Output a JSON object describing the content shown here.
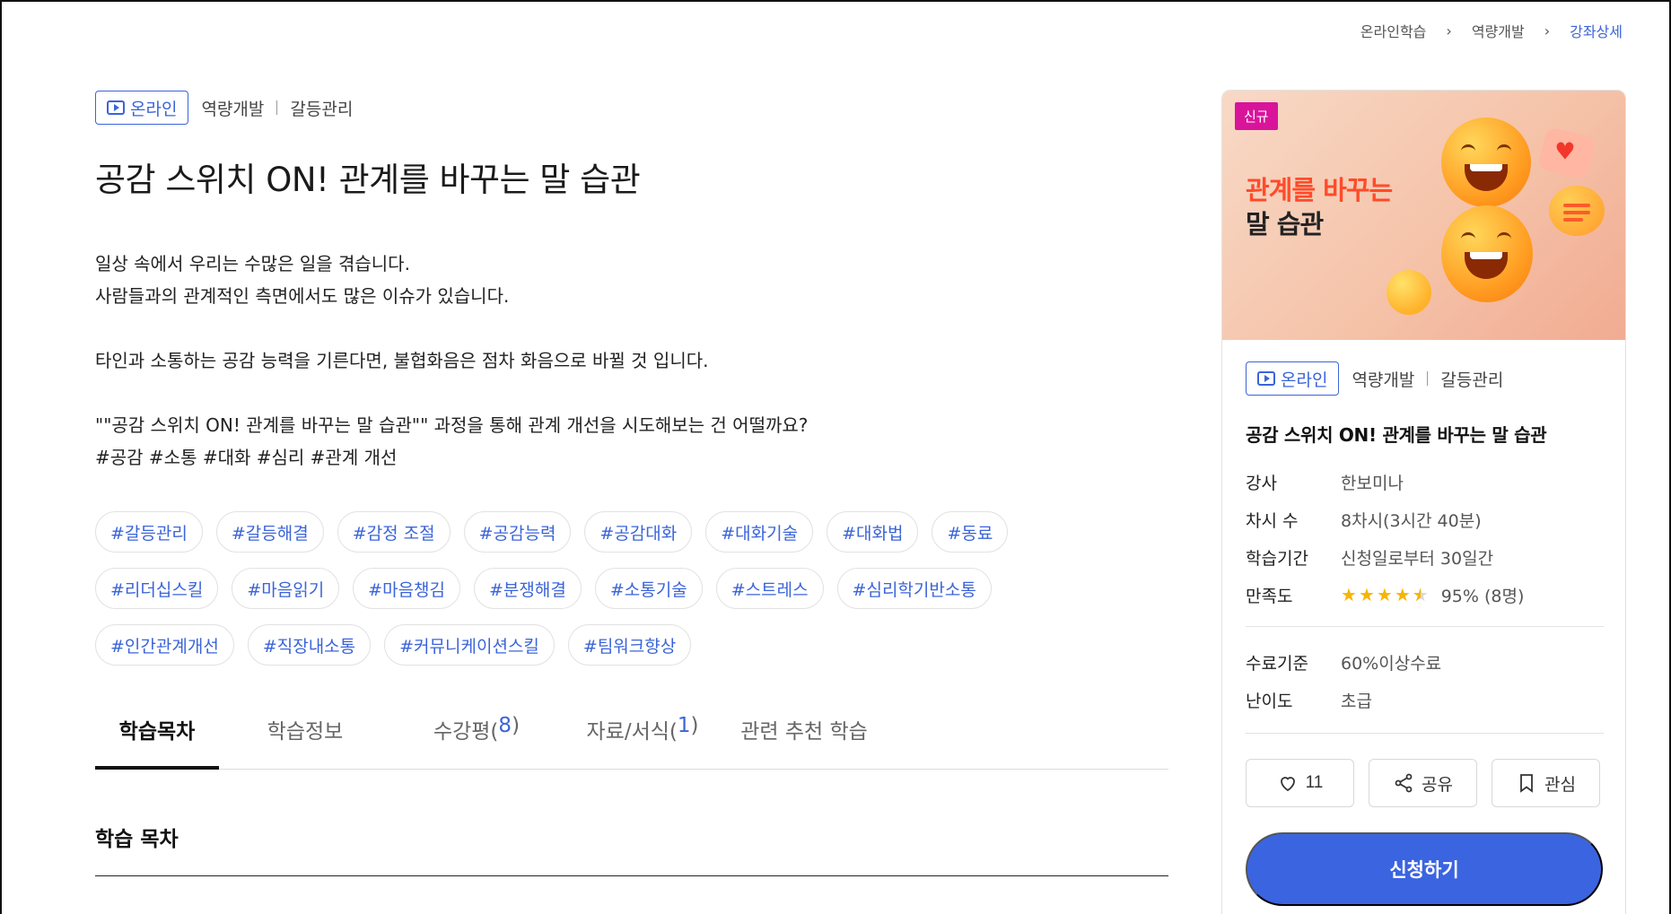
{
  "breadcrumb": {
    "items": [
      "온라인학습",
      "역량개발",
      "강좌상세"
    ]
  },
  "course": {
    "badge": "온라인",
    "category_main": "역량개발",
    "category_sub": "갈등관리",
    "title": "공감 스위치 ON! 관계를 바꾸는 말 습관",
    "description": [
      "일상 속에서 우리는 수많은 일을 겪습니다.",
      "사람들과의 관계적인 측면에서도 많은 이슈가 있습니다.",
      "",
      "타인과 소통하는 공감 능력을 기른다면, 불협화음은 점차 화음으로 바뀔 것 입니다.",
      "",
      "\"\"공감 스위치 ON! 관계를 바꾸는 말 습관\"\" 과정을 통해 관계 개선을 시도해보는 건 어떨까요?",
      "#공감 #소통 #대화 #심리 #관계 개선"
    ],
    "tags": [
      "#갈등관리",
      "#갈등해결",
      "#감정 조절",
      "#공감능력",
      "#공감대화",
      "#대화기술",
      "#대화법",
      "#동료",
      "#리더십스킬",
      "#마음읽기",
      "#마음챙김",
      "#분쟁해결",
      "#소통기술",
      "#스트레스",
      "#심리학기반소통",
      "#인간관계개선",
      "#직장내소통",
      "#커뮤니케이션스킬",
      "#팀워크향상"
    ]
  },
  "tabs": [
    {
      "label": "학습목차",
      "count": ""
    },
    {
      "label": "학습정보",
      "count": ""
    },
    {
      "label": "수강평(",
      "count": "8",
      "suffix": ")"
    },
    {
      "label": "자료/서식(",
      "count": "1",
      "suffix": ")"
    },
    {
      "label": "관련 추천 학습",
      "count": ""
    }
  ],
  "section": {
    "title": "학습 목차"
  },
  "card": {
    "new_badge": "신규",
    "thumb_line1": "관계를 바꾸는",
    "thumb_line2": "말 습관",
    "badge": "온라인",
    "category_main": "역량개발",
    "category_sub": "갈등관리",
    "title": "공감 스위치 ON! 관계를 바꾸는 말 습관",
    "instructor_label": "강사",
    "instructor": "한보미나",
    "lessons_label": "차시 수",
    "lessons": "8차시(3시간 40분)",
    "period_label": "학습기간",
    "period": "신청일로부터 30일간",
    "satisfaction_label": "만족도",
    "rating": 4.5,
    "rating_max": 5,
    "satisfaction": "95% (8명)",
    "completion_label": "수료기준",
    "completion": "60%이상수료",
    "difficulty_label": "난이도",
    "difficulty": "초급",
    "like_count": "11",
    "share_label": "공유",
    "bookmark_label": "관심",
    "apply_label": "신청하기"
  },
  "colors": {
    "accent": "#3b64d8",
    "apply_button": "#3b64e0",
    "new_badge": "#d9149b",
    "star": "#f7b500"
  },
  "icons": {
    "play": "play-icon",
    "chevron": "chevron-right-icon",
    "heart": "heart-icon",
    "share": "share-icon",
    "bookmark": "bookmark-icon",
    "star": "star-icon"
  }
}
